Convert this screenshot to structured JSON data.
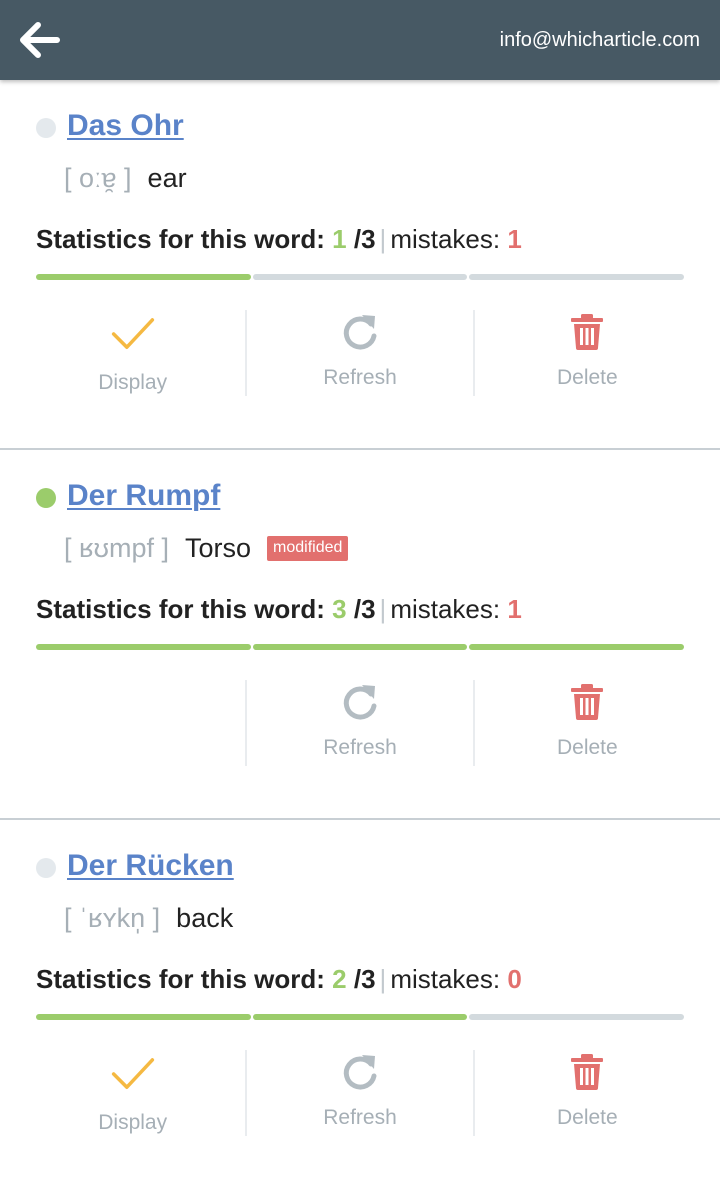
{
  "header": {
    "email": "info@whicharticle.com"
  },
  "colors": {
    "header_bg": "#475964",
    "link": "#5a83c9",
    "correct": "#9bcc6b",
    "mistake": "#e2706e",
    "pending_dot": "#e4e9ed",
    "done_dot": "#9bcc6b",
    "display_check": "#f5b942",
    "refresh_icon": "#b3bcc2",
    "delete_icon": "#e2706e"
  },
  "stats_label": "Statistics for this word:",
  "mistakes_label": "mistakes:",
  "actions": {
    "display": "Display",
    "refresh": "Refresh",
    "delete": "Delete"
  },
  "words": [
    {
      "title": "Das Ohr",
      "phonetic": "[ oːɐ̯ ]",
      "translation": "ear",
      "badge": "",
      "correct": "1",
      "total": "/3",
      "mistakes": "1",
      "progress_filled": 1,
      "progress_segments": 3,
      "learned": false,
      "show_display": true
    },
    {
      "title": "Der Rumpf",
      "phonetic": "[ ʁʊmpf ]",
      "translation": "Torso",
      "badge": "modifided",
      "correct": "3",
      "total": "/3",
      "mistakes": "1",
      "progress_filled": 3,
      "progress_segments": 3,
      "learned": true,
      "show_display": false
    },
    {
      "title": "Der Rücken",
      "phonetic": "[ ˈʁʏkn̩ ]",
      "translation": "back",
      "badge": "",
      "correct": "2",
      "total": "/3",
      "mistakes": "0",
      "progress_filled": 2,
      "progress_segments": 3,
      "learned": false,
      "show_display": true
    }
  ]
}
